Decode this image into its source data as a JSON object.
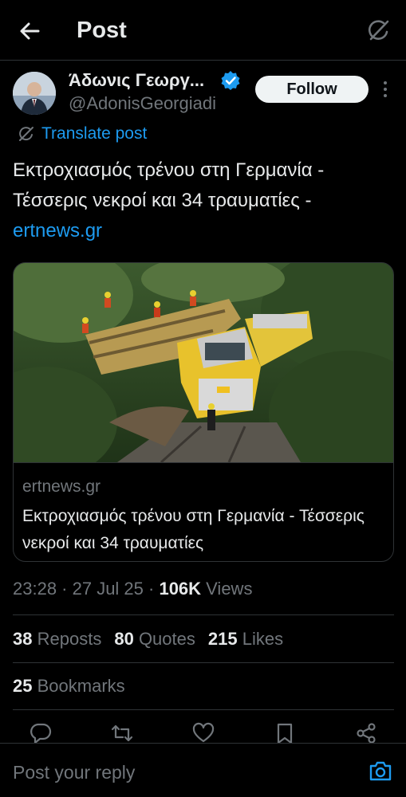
{
  "header": {
    "title": "Post",
    "back_icon": "arrow-left-icon",
    "grok_icon": "grok-icon"
  },
  "author": {
    "name": "Άδωνις Γεωργ...",
    "handle": "@AdonisGeorgiadi",
    "follow_label": "Follow",
    "verified_color": "#1d9bf0"
  },
  "translate_label": "Translate post",
  "tweet": {
    "text": "Εκτροχιασμός τρένου στη Γερμανία - Τέσσερις νεκροί και 34 τραυματίες - ",
    "link": "ertnews.gr"
  },
  "card": {
    "domain": "ertnews.gr",
    "title": "Εκτροχιασμός τρένου στη Γερμανία - Τέσσερις νεκροί και 34 τραυματίες"
  },
  "meta": {
    "time_date": "23:28 · 27 Jul 25 · ",
    "views_count": "106K",
    "views_label": " Views"
  },
  "stats": {
    "reposts_count": "38",
    "reposts_label": "Reposts",
    "quotes_count": "80",
    "quotes_label": "Quotes",
    "likes_count": "215",
    "likes_label": "Likes",
    "bookmarks_count": "25",
    "bookmarks_label": "Bookmarks"
  },
  "reply": {
    "placeholder": "Post your reply"
  },
  "colors": {
    "accent": "#1d9bf0",
    "background": "#000000",
    "muted": "#71767b",
    "border": "#2f3336"
  }
}
